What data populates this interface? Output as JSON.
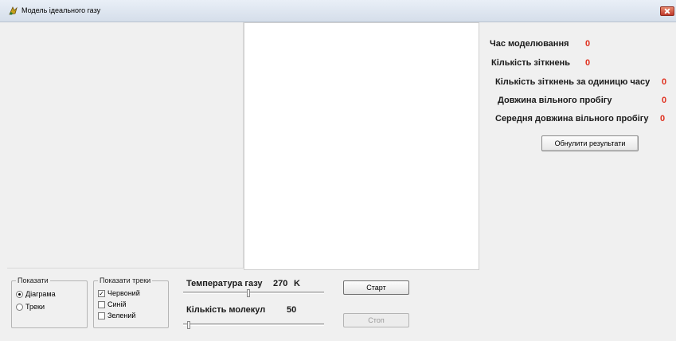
{
  "window": {
    "title": "Модель ідеального газу",
    "close_icon": "close-icon"
  },
  "stats": [
    {
      "label": "Час моделювання",
      "value": "0"
    },
    {
      "label": "Кількість зіткнень",
      "value": "0"
    },
    {
      "label": "Кількість зіткнень за одиницю часу",
      "value": "0"
    },
    {
      "label": "Довжина вільного пробігу",
      "value": "0"
    },
    {
      "label": "Середня довжина вільного пробігу",
      "value": "0"
    }
  ],
  "reset_button": "Обнулити результати",
  "show_group": {
    "title": "Показати",
    "options": [
      "Діаграма",
      "Треки"
    ],
    "selected": "Діаграма"
  },
  "tracks_group": {
    "title": "Показати треки",
    "options": [
      {
        "label": "Червоний",
        "checked": true
      },
      {
        "label": "Синій",
        "checked": false
      },
      {
        "label": "Зелений",
        "checked": false
      }
    ]
  },
  "temperature": {
    "label": "Температура газу",
    "value": "270",
    "unit": "K",
    "level": 0.46
  },
  "molecules": {
    "label": "Кількість молекул",
    "value": "50",
    "level": 0.03
  },
  "start_button": "Старт",
  "stop_button": "Стоп",
  "colors": {
    "accent_value": "#e0301e",
    "canvas": "#ffffff"
  }
}
